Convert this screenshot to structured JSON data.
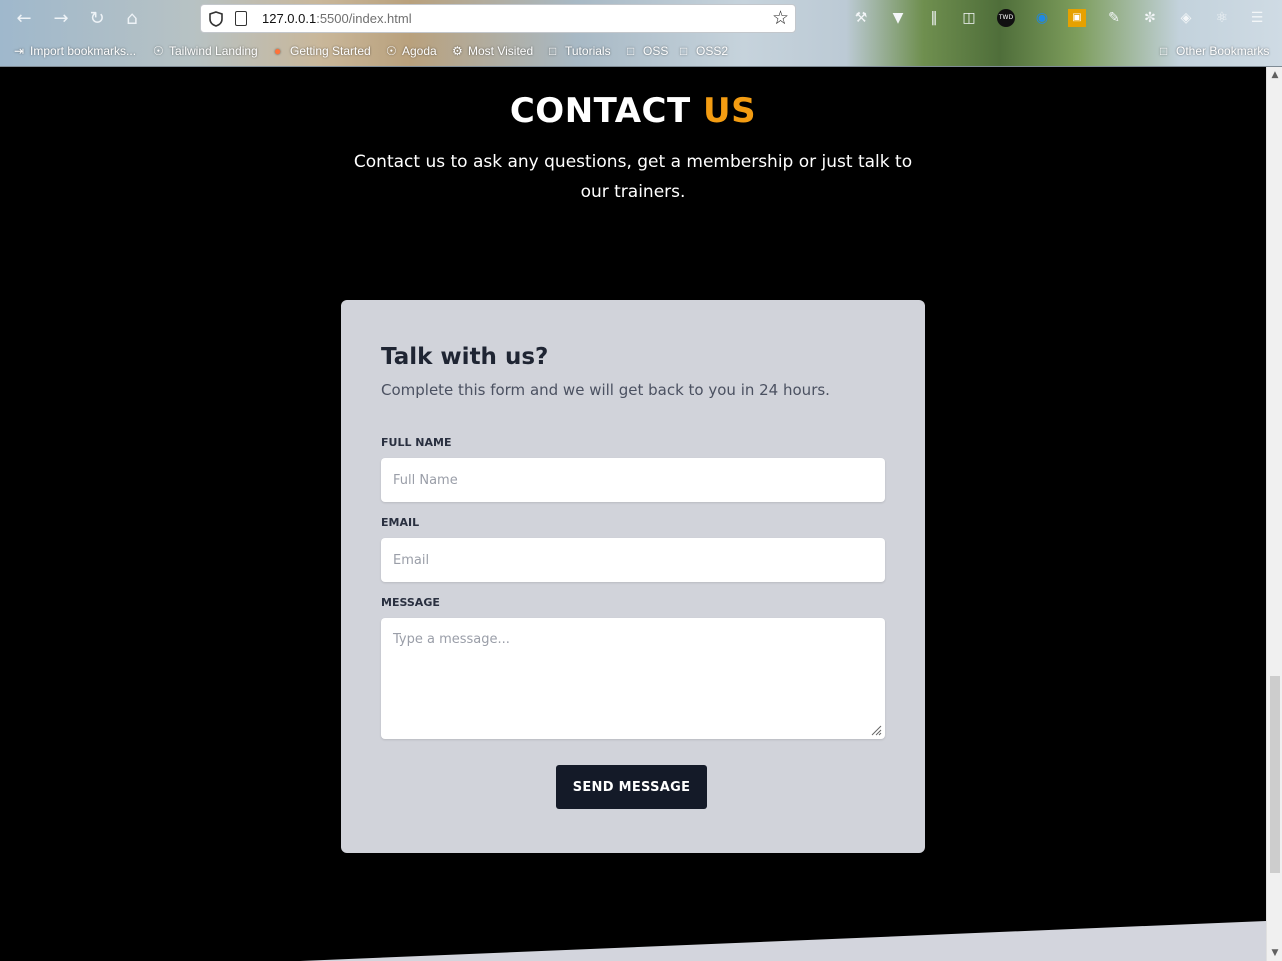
{
  "browser": {
    "url_host": "127.0.0.1",
    "url_rest": ":5500/index.html",
    "bookmarks": [
      {
        "label": "Import bookmarks...",
        "icon": "import-icon"
      },
      {
        "label": "Tailwind Landing",
        "icon": "globe-icon"
      },
      {
        "label": "Getting Started",
        "icon": "firefox-icon"
      },
      {
        "label": "Agoda",
        "icon": "globe-icon"
      },
      {
        "label": "Most Visited",
        "icon": "gear-icon"
      },
      {
        "label": "Tutorials",
        "icon": "folder-icon"
      },
      {
        "label": "OSS",
        "icon": "folder-icon"
      },
      {
        "label": "OSS2",
        "icon": "folder-icon"
      }
    ],
    "other_bookmarks": "Other Bookmarks"
  },
  "contact": {
    "title_main": "CONTACT",
    "title_accent": "US",
    "accent_color": "#f39c12",
    "subtitle": "Contact us to ask any questions, get a membership or just talk to our trainers."
  },
  "form": {
    "heading": "Talk with us?",
    "lead": "Complete this form and we will get back to you in 24 hours.",
    "name_label": "FULL NAME",
    "name_placeholder": "Full Name",
    "email_label": "EMAIL",
    "email_placeholder": "Email",
    "message_label": "MESSAGE",
    "message_placeholder": "Type a message...",
    "submit_label": "SEND MESSAGE"
  }
}
